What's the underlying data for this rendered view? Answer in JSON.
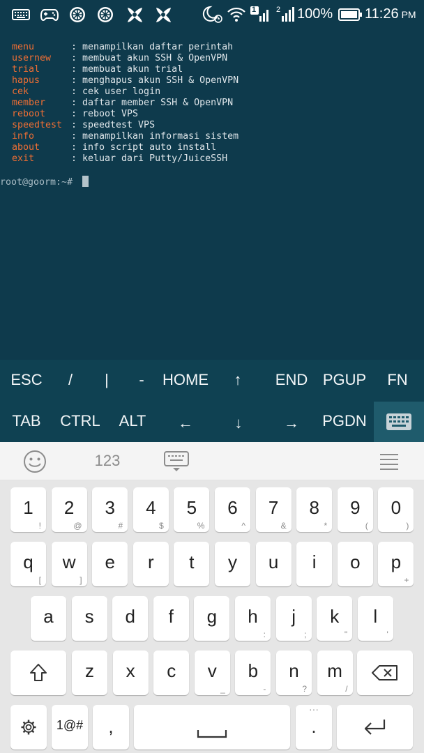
{
  "status_bar": {
    "battery_pct": "100%",
    "time": "11:26",
    "ampm": "PM",
    "sim1_badge": "1",
    "sim2_badge": "2",
    "icons": [
      "keyboard-icon",
      "gamepad-icon",
      "citrus-icon",
      "citrus-icon",
      "avast-icon",
      "avast-icon",
      "moon-alarm-icon",
      "wifi-icon",
      "signal-icon",
      "signal-icon",
      "battery-icon"
    ]
  },
  "terminal": {
    "menu": [
      {
        "cmd": "menu",
        "sep": ":",
        "desc": "menampilkan daftar perintah"
      },
      {
        "cmd": "usernew",
        "sep": ":",
        "desc": "membuat akun SSH & OpenVPN"
      },
      {
        "cmd": "trial",
        "sep": ":",
        "desc": "membuat akun trial"
      },
      {
        "cmd": "hapus",
        "sep": ":",
        "desc": "menghapus akun SSH & OpenVPN"
      },
      {
        "cmd": "cek",
        "sep": ":",
        "desc": "cek user login"
      },
      {
        "cmd": "member",
        "sep": ":",
        "desc": "daftar member SSH & OpenVPN"
      },
      {
        "cmd": "reboot",
        "sep": ":",
        "desc": "reboot VPS"
      },
      {
        "cmd": "speedtest",
        "sep": ":",
        "desc": "speedtest VPS"
      },
      {
        "cmd": "info",
        "sep": ":",
        "desc": "menampilkan informasi sistem"
      },
      {
        "cmd": "about",
        "sep": ":",
        "desc": "info script auto install"
      },
      {
        "cmd": "exit",
        "sep": ":",
        "desc": "keluar dari Putty/JuiceSSH"
      }
    ],
    "prompt": "root@goorm:~#",
    "colors": {
      "background": "#0e3a4c",
      "command": "#ee6e34",
      "text": "#dfe6ea"
    }
  },
  "extra_keys": {
    "row1": [
      "ESC",
      "/",
      "|",
      "-",
      "HOME",
      "↑",
      "END",
      "PGUP",
      "FN"
    ],
    "row2": [
      "TAB",
      "CTRL",
      "ALT",
      "←",
      "↓",
      "→",
      "PGDN"
    ],
    "keyboard_toggle_icon": "keyboard-icon"
  },
  "keyboard_toolbar": {
    "emoji_icon": "smiley-icon",
    "numbers_label": "123",
    "hide_keyboard_icon": "keyboard-down-icon",
    "menu_icon": "menu-icon"
  },
  "keyboard": {
    "row1": [
      {
        "main": "1",
        "sub": "!"
      },
      {
        "main": "2",
        "sub": "@"
      },
      {
        "main": "3",
        "sub": "#"
      },
      {
        "main": "4",
        "sub": "$"
      },
      {
        "main": "5",
        "sub": "%"
      },
      {
        "main": "6",
        "sub": "^"
      },
      {
        "main": "7",
        "sub": "&"
      },
      {
        "main": "8",
        "sub": "*"
      },
      {
        "main": "9",
        "sub": "("
      },
      {
        "main": "0",
        "sub": ")"
      }
    ],
    "row2": [
      {
        "main": "q",
        "sub": "["
      },
      {
        "main": "w",
        "sub": "]"
      },
      {
        "main": "e",
        "sub": ""
      },
      {
        "main": "r",
        "sub": ""
      },
      {
        "main": "t",
        "sub": ""
      },
      {
        "main": "y",
        "sub": ""
      },
      {
        "main": "u",
        "sub": ""
      },
      {
        "main": "i",
        "sub": ""
      },
      {
        "main": "o",
        "sub": ""
      },
      {
        "main": "p",
        "sub": "+"
      }
    ],
    "row3": [
      {
        "main": "a",
        "sub": ""
      },
      {
        "main": "s",
        "sub": ""
      },
      {
        "main": "d",
        "sub": ""
      },
      {
        "main": "f",
        "sub": ""
      },
      {
        "main": "g",
        "sub": ""
      },
      {
        "main": "h",
        "sub": ":"
      },
      {
        "main": "j",
        "sub": ";"
      },
      {
        "main": "k",
        "sub": "\""
      },
      {
        "main": "l",
        "sub": "'"
      }
    ],
    "row4": [
      {
        "main": "z",
        "sub": ""
      },
      {
        "main": "x",
        "sub": ""
      },
      {
        "main": "c",
        "sub": ""
      },
      {
        "main": "v",
        "sub": "_"
      },
      {
        "main": "b",
        "sub": "-"
      },
      {
        "main": "n",
        "sub": "?"
      },
      {
        "main": "m",
        "sub": "/"
      }
    ],
    "shift_icon": "shift-icon",
    "backspace_icon": "backspace-icon",
    "settings_icon": "gear-icon",
    "symbols_label": "1@#",
    "comma_label": ",",
    "space_icon": "space-icon",
    "period_label": ".",
    "period_more": "···",
    "enter_icon": "enter-icon"
  }
}
